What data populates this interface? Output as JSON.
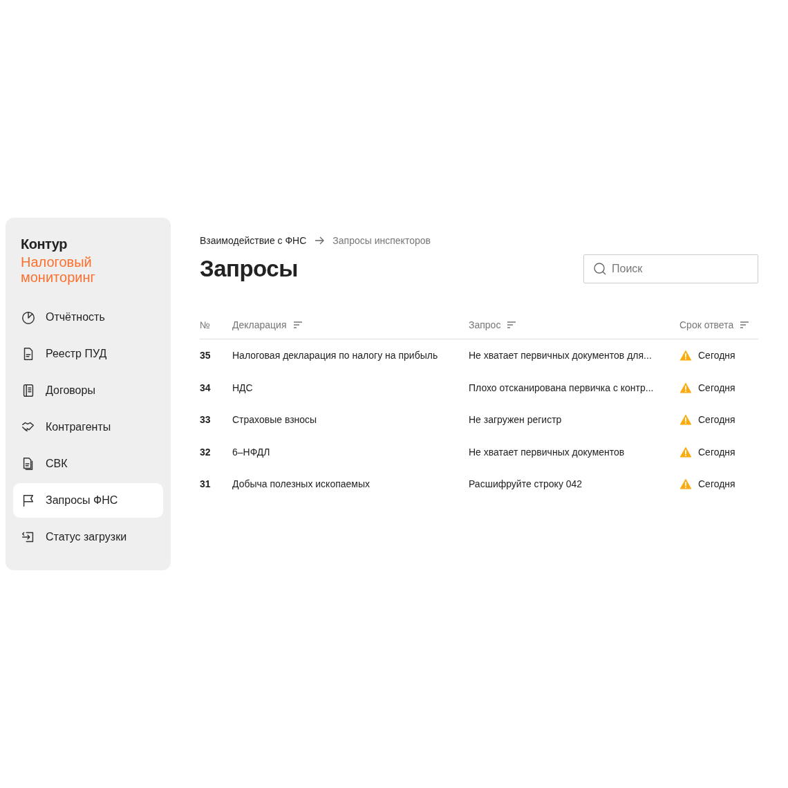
{
  "sidebar": {
    "brand": "Контур",
    "product_lines": [
      "Налоговый",
      "мониторинг"
    ],
    "items": [
      {
        "label": "Отчётность",
        "selected": false
      },
      {
        "label": "Реестр ПУД",
        "selected": false
      },
      {
        "label": "Договоры",
        "selected": false
      },
      {
        "label": "Контрагенты",
        "selected": false
      },
      {
        "label": "СВК",
        "selected": false
      },
      {
        "label": "Запросы ФНС",
        "selected": true
      },
      {
        "label": "Статус загрузки",
        "selected": false
      }
    ]
  },
  "breadcrumbs": [
    "Взаимодействие с ФНС",
    "Запросы инспекторов"
  ],
  "title": "Запросы",
  "search": {
    "placeholder": "Поиск"
  },
  "table": {
    "columns": [
      {
        "label": "№",
        "sortable": false
      },
      {
        "label": "Декларация",
        "sortable": true
      },
      {
        "label": "Запрос",
        "sortable": true
      },
      {
        "label": "Срок ответа",
        "sortable": true
      }
    ],
    "rows": [
      {
        "number": "35",
        "declaration": "Налоговая декларация по налогу на прибыль",
        "request": "Не хватает первичных документов для...",
        "deadline": "Сегодня",
        "warning": true
      },
      {
        "number": "34",
        "declaration": "НДС",
        "request": "Плохо отсканирована первичка с контр...",
        "deadline": "Сегодня",
        "warning": true
      },
      {
        "number": "33",
        "declaration": "Страховые взносы",
        "request": "Не загружен регистр",
        "deadline": "Сегодня",
        "warning": true
      },
      {
        "number": "32",
        "declaration": "6–НФДЛ",
        "request": "Не хватает первичных документов",
        "deadline": "Сегодня",
        "warning": true
      },
      {
        "number": "31",
        "declaration": "Добыча полезных ископаемых",
        "request": "Расшифруйте строку 042",
        "deadline": "Сегодня",
        "warning": true
      }
    ]
  }
}
